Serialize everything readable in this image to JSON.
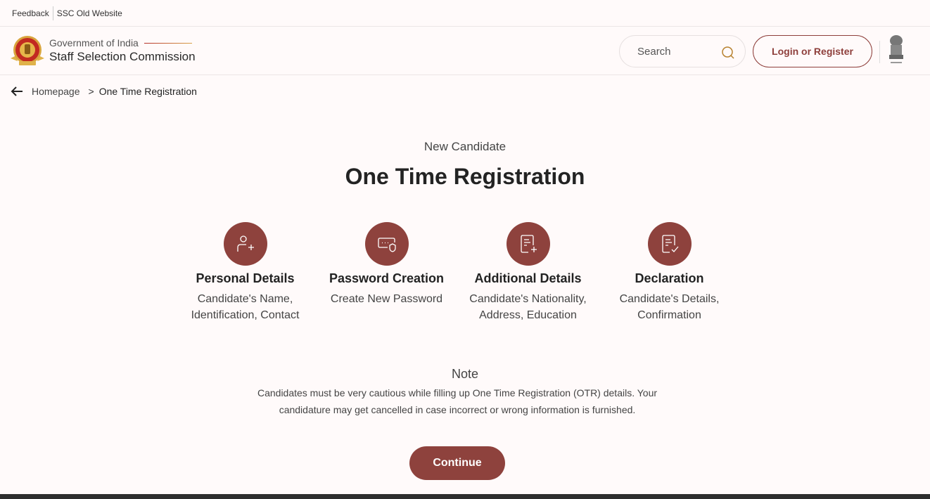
{
  "topbar": {
    "links": [
      "Feedback",
      "SSC Old Website"
    ]
  },
  "header": {
    "gov_label": "Government of India",
    "org_name": "Staff Selection Commission",
    "search_placeholder": "Search",
    "login_label": "Login or Register",
    "icons": {
      "logo": "ssc-logo-icon",
      "search": "search-icon",
      "emblem": "national-emblem-icon"
    }
  },
  "breadcrumb": {
    "back_icon": "arrow-left-icon",
    "home": "Homepage",
    "separator": ">",
    "current": "One Time Registration"
  },
  "main": {
    "subtitle": "New Candidate",
    "title": "One Time Registration",
    "steps": [
      {
        "icon": "user-add-icon",
        "name": "Personal Details",
        "desc": "Candidate's Name, Identification, Contact"
      },
      {
        "icon": "password-shield-icon",
        "name": "Password Creation",
        "desc": "Create New Password"
      },
      {
        "icon": "document-add-icon",
        "name": "Additional Details",
        "desc": "Candidate's Nationality, Address, Education"
      },
      {
        "icon": "document-check-icon",
        "name": "Declaration",
        "desc": "Candidate's Details, Confirmation"
      }
    ],
    "note_title": "Note",
    "note_text": "Candidates must be very cautious while filling up One Time Registration (OTR) details. Your candidature may get cancelled in case incorrect or wrong information is furnished.",
    "continue_label": "Continue"
  },
  "colors": {
    "accent": "#8e423d",
    "background": "#fffafa",
    "search_icon": "#b7812f"
  }
}
